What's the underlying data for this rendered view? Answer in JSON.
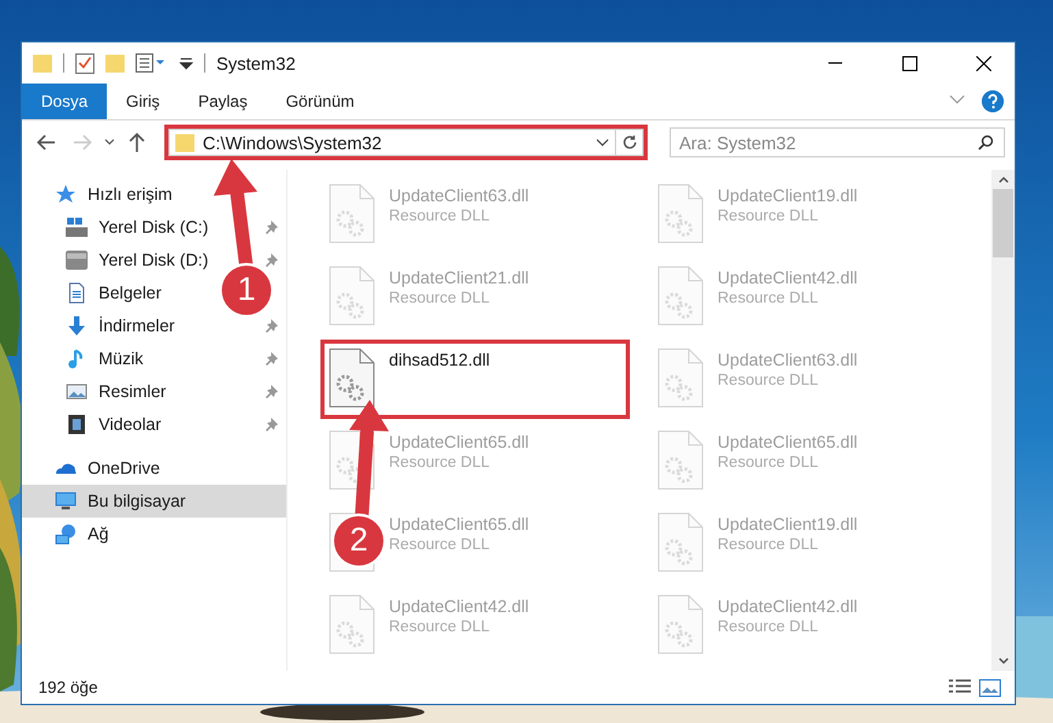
{
  "window": {
    "title": "System32"
  },
  "ribbon_tabs": [
    {
      "label": "Dosya",
      "selected": true
    },
    {
      "label": "Giriş",
      "selected": false
    },
    {
      "label": "Paylaş",
      "selected": false
    },
    {
      "label": "Görünüm",
      "selected": false
    }
  ],
  "address_bar": {
    "path": "C:\\Windows\\System32",
    "highlighted": true
  },
  "search": {
    "placeholder": "Ara: System32"
  },
  "sidebar": {
    "items": [
      {
        "label": "Hızlı erişim",
        "selected": false,
        "children": [
          {
            "label": "Yerel Disk (C:)",
            "pinned": true
          },
          {
            "label": "Yerel Disk (D:)",
            "pinned": true
          },
          {
            "label": "Belgeler",
            "pinned": false
          },
          {
            "label": "İndirmeler",
            "pinned": true
          },
          {
            "label": "Müzik",
            "pinned": true
          },
          {
            "label": "Resimler",
            "pinned": true
          },
          {
            "label": "Videolar",
            "pinned": true
          }
        ]
      },
      {
        "label": "OneDrive",
        "selected": false
      },
      {
        "label": "Bu bilgisayar",
        "selected": true
      },
      {
        "label": "Ağ",
        "selected": false
      }
    ]
  },
  "files": [
    {
      "name": "UpdateClient63.dll",
      "type": "Resource DLL",
      "blurred": true,
      "highlighted": false
    },
    {
      "name": "UpdateClient19.dll",
      "type": "Resource DLL",
      "blurred": true,
      "highlighted": false
    },
    {
      "name": "UpdateClient21.dll",
      "type": "Resource DLL",
      "blurred": true,
      "highlighted": false
    },
    {
      "name": "UpdateClient42.dll",
      "type": "Resource DLL",
      "blurred": true,
      "highlighted": false
    },
    {
      "name": "dihsad512.dll",
      "blurred": false,
      "highlighted": true
    },
    {
      "name": "UpdateClient63.dll",
      "type": "Resource DLL",
      "blurred": true,
      "highlighted": false
    },
    {
      "name": "UpdateClient65.dll",
      "type": "Resource DLL",
      "blurred": true,
      "highlighted": false
    },
    {
      "name": "UpdateClient65.dll",
      "type": "Resource DLL",
      "blurred": true,
      "highlighted": false
    },
    {
      "name": "UpdateClient65.dll",
      "type": "Resource DLL",
      "blurred": true,
      "highlighted": false
    },
    {
      "name": "UpdateClient19.dll",
      "type": "Resource DLL",
      "blurred": true,
      "highlighted": false
    },
    {
      "name": "UpdateClient42.dll",
      "type": "Resource DLL",
      "blurred": true,
      "highlighted": false
    },
    {
      "name": "UpdateClient42.dll",
      "type": "Resource DLL",
      "blurred": true,
      "highlighted": false
    }
  ],
  "status_bar": {
    "item_count": "192 öğe"
  },
  "callouts": [
    {
      "number": "1"
    },
    {
      "number": "2"
    }
  ]
}
